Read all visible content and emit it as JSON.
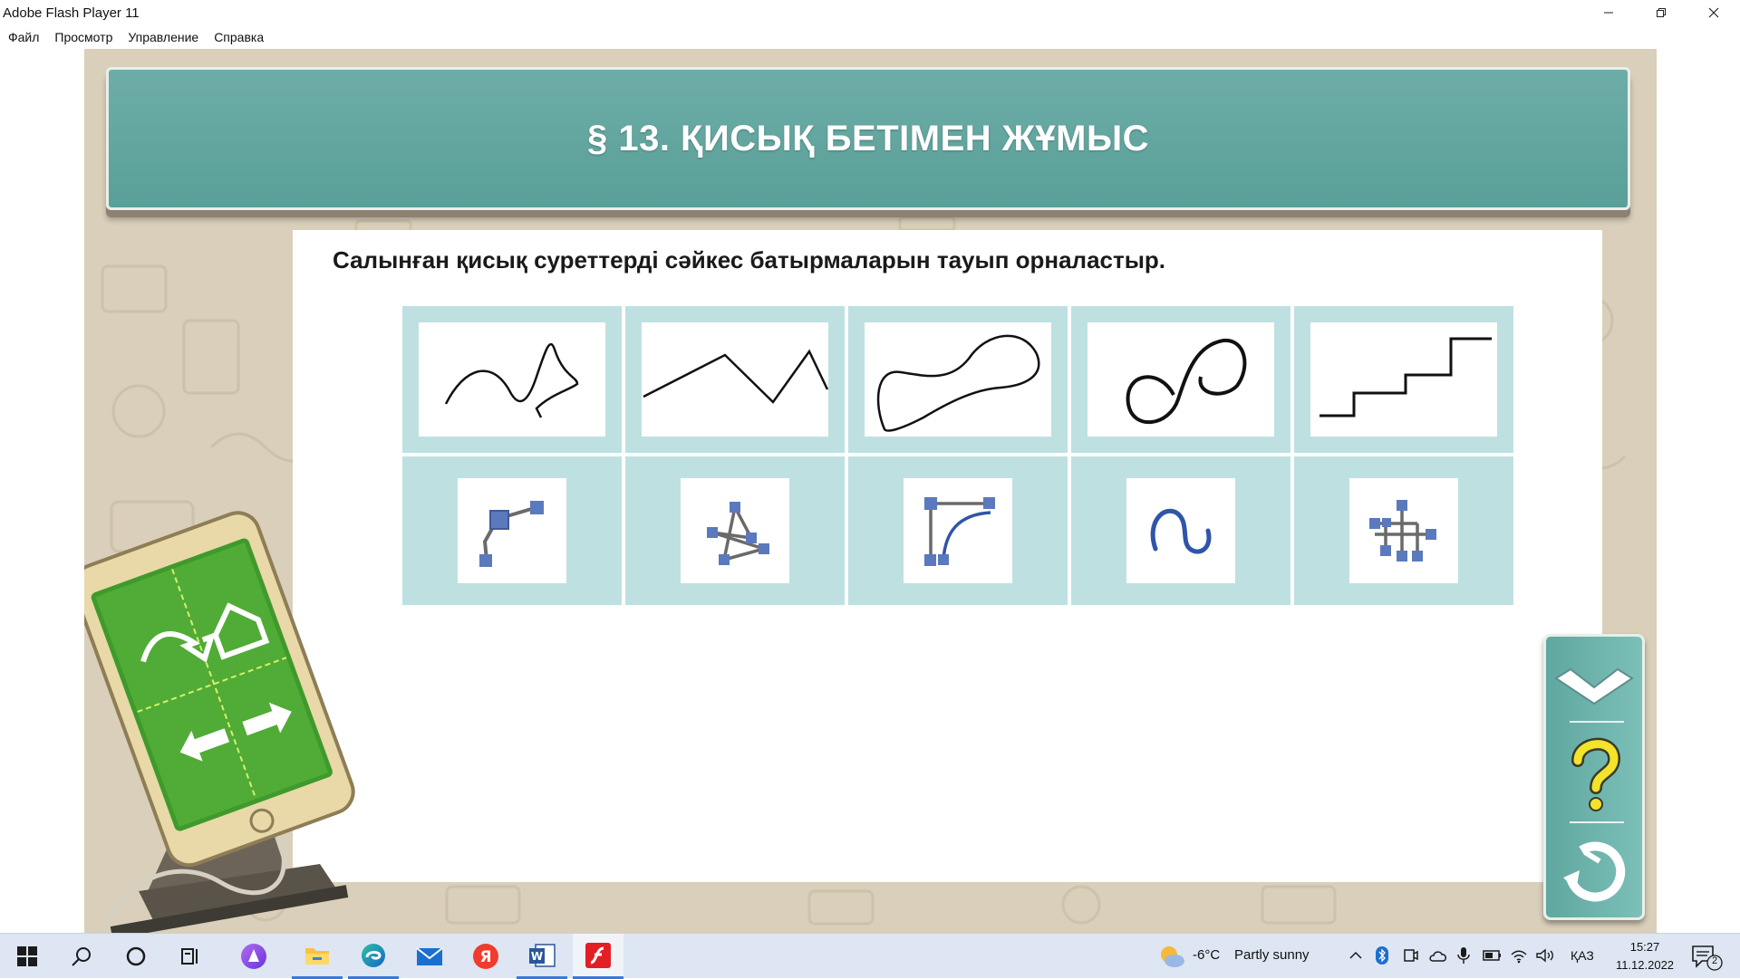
{
  "window": {
    "title": "Adobe Flash Player 11",
    "menu": [
      "Файл",
      "Просмотр",
      "Управление",
      "Справка"
    ]
  },
  "lesson": {
    "title": "§ 13. ҚИСЫҚ БЕТІМЕН ЖҰМЫС",
    "instruction": "Салынған қисық суреттерді сәйкес батырмаларын тауып орналастыр."
  },
  "exercise": {
    "curves": [
      "freeform-curve",
      "polyline-zigzag",
      "closed-freeform-loop",
      "spiral-loop",
      "staircase-line"
    ],
    "tools": [
      "polyline-tool-icon",
      "star-points-tool-icon",
      "corner-curve-tool-icon",
      "scribble-tool-icon",
      "edit-points-tool-icon"
    ]
  },
  "side_panel": {
    "buttons": [
      "check-icon",
      "help-icon",
      "restart-icon"
    ]
  },
  "colors": {
    "banner": "#5fa39d",
    "cell": "#bfe0e0",
    "tool_blue": "#5b79bd",
    "help_yellow": "#f3e32b"
  },
  "taskbar": {
    "apps": [
      "start-icon",
      "search-icon",
      "cortana-icon",
      "task-view-icon",
      "alice-icon",
      "file-explorer-icon",
      "edge-icon",
      "mail-icon",
      "yandex-icon",
      "word-icon",
      "flash-icon"
    ],
    "weather": {
      "temp": "-6°C",
      "desc": "Partly sunny"
    },
    "lang": "ҚАЗ",
    "time": "15:27",
    "date": "11.12.2022",
    "notifications": "2"
  }
}
